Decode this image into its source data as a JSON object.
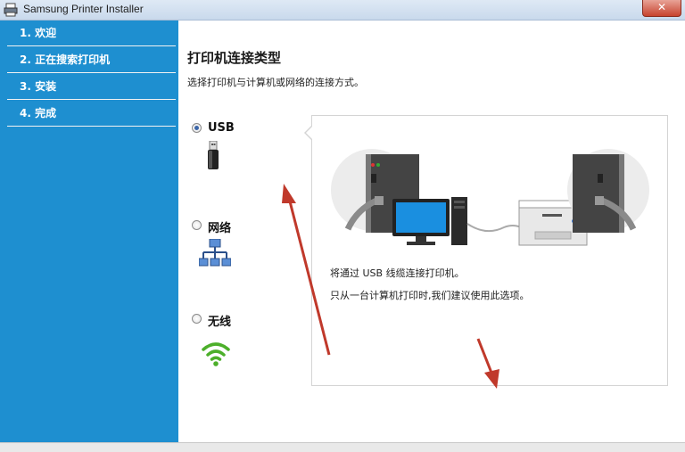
{
  "window": {
    "title": "Samsung Printer Installer",
    "close_label": "✕",
    "app_icon": "printer-icon"
  },
  "sidebar": {
    "items": [
      {
        "label": "1. 欢迎"
      },
      {
        "label": "2. 正在搜索打印机"
      },
      {
        "label": "3. 安装"
      },
      {
        "label": "4. 完成"
      }
    ]
  },
  "main": {
    "title": "打印机连接类型",
    "subtitle": "选择打印机与计算机或网络的连接方式。",
    "options": [
      {
        "label": "USB",
        "selected": true,
        "icon": "usb-icon"
      },
      {
        "label": "网络",
        "selected": false,
        "icon": "network-icon"
      },
      {
        "label": "无线",
        "selected": false,
        "icon": "wifi-icon"
      }
    ],
    "panel": {
      "line1": "将通过 USB 线缆连接打印机。",
      "line2": "只从一台计算机打印时,我们建议使用此选项。"
    }
  },
  "colors": {
    "sidebar": "#1e8fd0",
    "annotation_arrow": "#c0392b"
  }
}
